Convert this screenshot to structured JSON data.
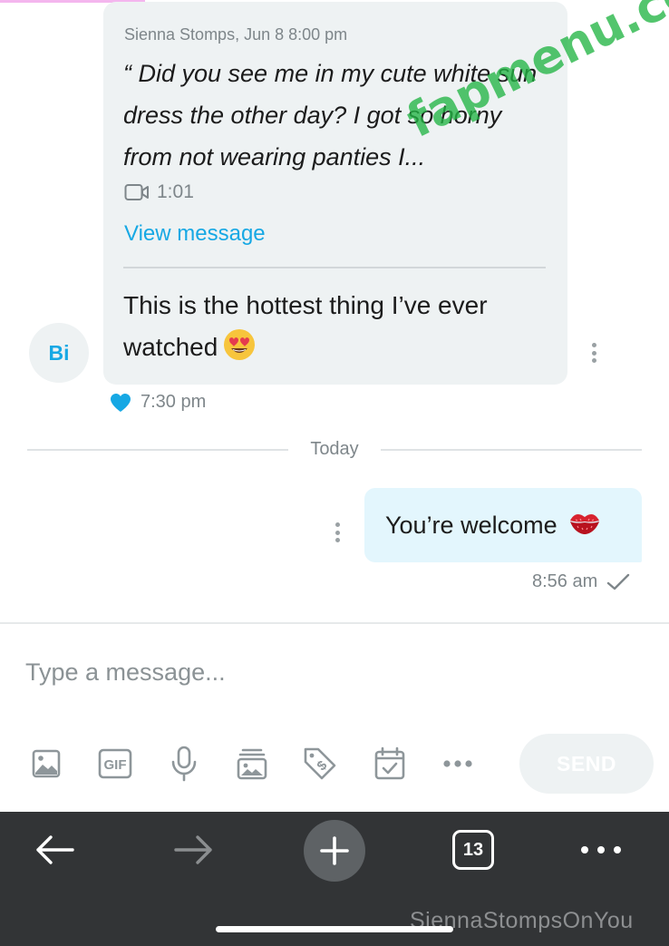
{
  "incoming": {
    "quote_meta": "Sienna Stomps, Jun 8 8:00 pm",
    "quote_text": "“ Did you see me in my cute white sun dress the other day? I got so horny from not wearing panties I...",
    "video_duration": "1:01",
    "view_message_label": "View message",
    "reply_text": "This is the hottest thing I’ve ever watched",
    "reply_emoji": "heart-eyes-emoji",
    "time": "7:30 pm",
    "liked": true
  },
  "avatar": {
    "initials": "Bi"
  },
  "day_separator": "Today",
  "outgoing": {
    "text": "You’re welcome",
    "emoji": "kiss-mark-emoji",
    "time": "8:56 am",
    "status": "sent-check-icon"
  },
  "composer": {
    "placeholder": "Type a message...",
    "tools": [
      "image-icon",
      "gif-icon",
      "microphone-icon",
      "vault-media-icon",
      "price-tag-icon",
      "schedule-calendar-icon",
      "more-options-icon"
    ],
    "gif_label": "GIF",
    "send_label": "SEND"
  },
  "browser_bar": {
    "tab_count": "13",
    "icons": [
      "back-arrow-icon",
      "forward-arrow-icon",
      "new-tab-plus-icon",
      "tab-switcher-icon",
      "menu-dots-icon"
    ]
  },
  "watermarks": {
    "diagonal": "fapmenu.com",
    "corner": "SiennaStompsOnYou"
  },
  "colors": {
    "accent": "#16a8e4",
    "incoming_bubble": "#eef2f3",
    "outgoing_bubble": "#e3f6fd",
    "browser_bar": "#323436",
    "watermark": "#22b544"
  }
}
